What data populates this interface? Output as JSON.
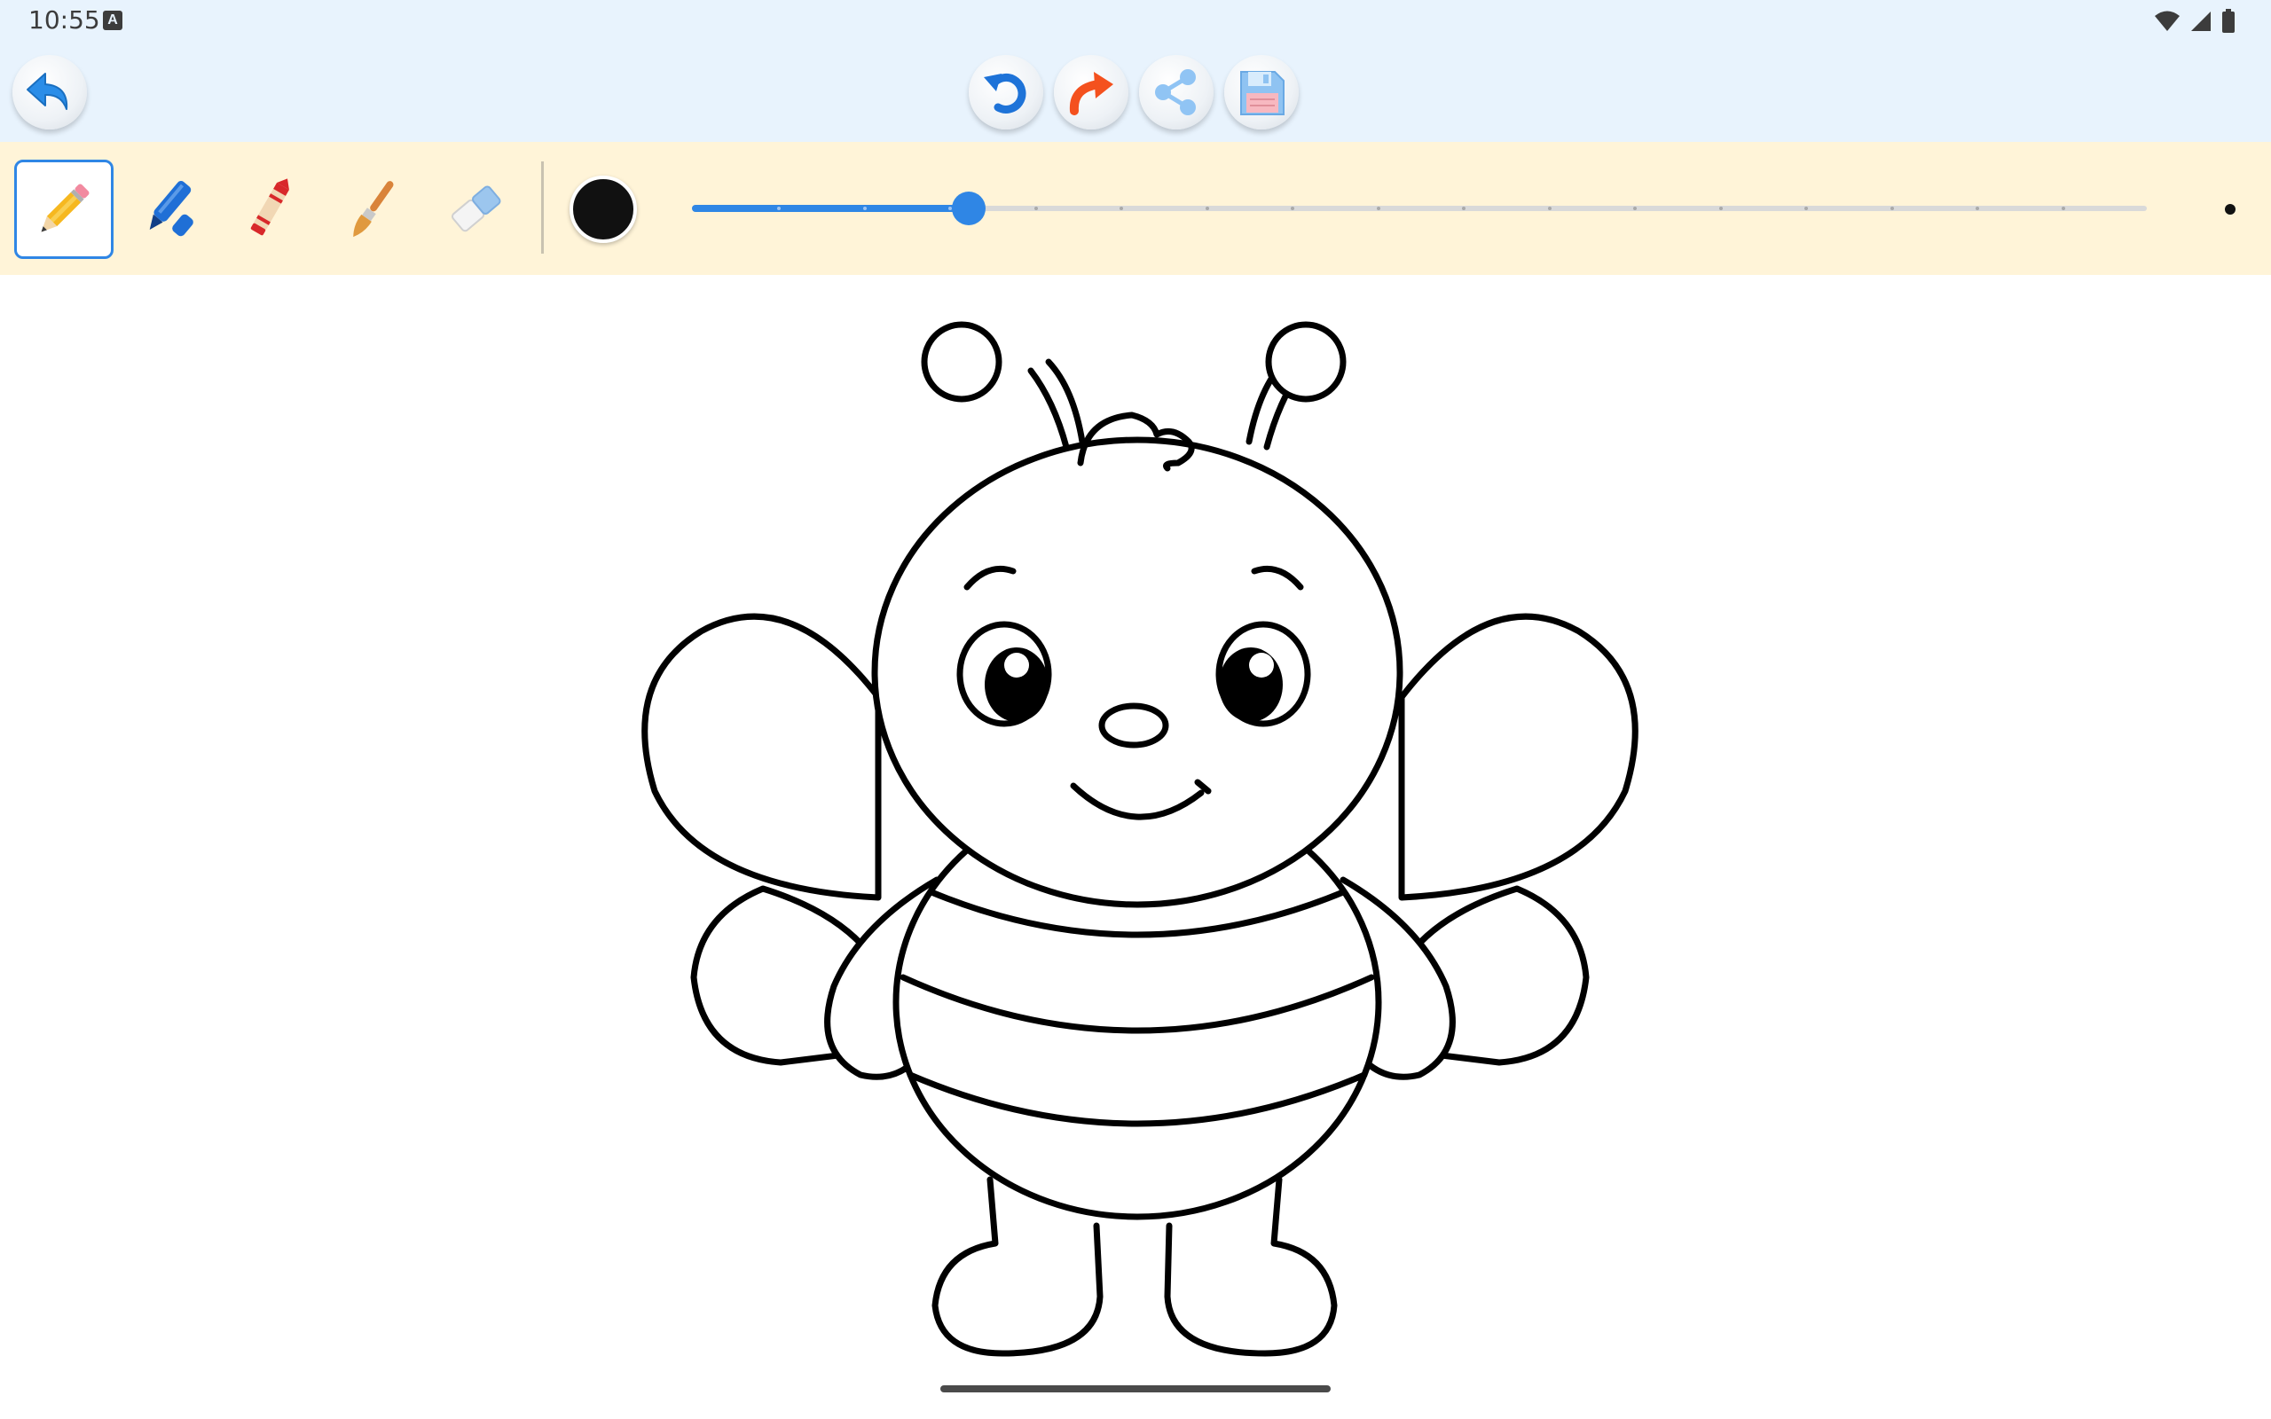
{
  "status_bar": {
    "time": "10:55",
    "notification_icon": "A",
    "icons": [
      "wifi-icon",
      "signal-icon",
      "battery-icon"
    ]
  },
  "top_bar": {
    "back_icon": "back-arrow-icon",
    "actions": [
      {
        "name": "undo",
        "icon": "undo-icon",
        "color": "#1e88e5"
      },
      {
        "name": "redo",
        "icon": "redo-icon",
        "color": "#f4511e"
      },
      {
        "name": "share",
        "icon": "share-icon",
        "color": "#90caf9"
      },
      {
        "name": "save",
        "icon": "save-icon",
        "color": "#90caf9"
      }
    ]
  },
  "tools": [
    {
      "name": "pencil",
      "icon": "pencil-icon",
      "selected": true
    },
    {
      "name": "marker",
      "icon": "marker-icon",
      "selected": false
    },
    {
      "name": "crayon",
      "icon": "crayon-icon",
      "selected": false
    },
    {
      "name": "brush",
      "icon": "paintbrush-icon",
      "selected": false
    },
    {
      "name": "eraser",
      "icon": "eraser-icon",
      "selected": false
    }
  ],
  "brush": {
    "color": "#111111",
    "size_fraction": 0.19,
    "tick_count": 17
  },
  "canvas": {
    "image": "bee-coloring-page"
  }
}
